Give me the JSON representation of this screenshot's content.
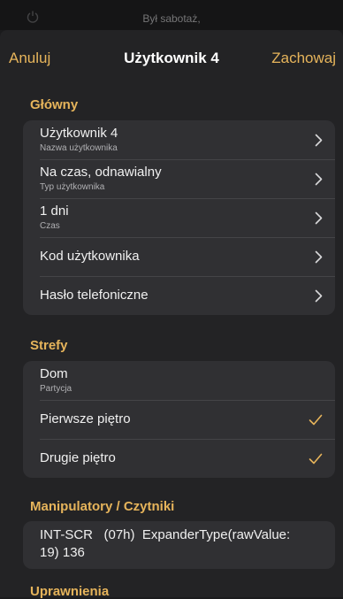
{
  "status": {
    "text": "Był sabotaż,"
  },
  "nav": {
    "cancel": "Anuluj",
    "title": "Użytkownik 4",
    "save": "Zachowaj"
  },
  "sections": {
    "main": {
      "header": "Główny",
      "rows": [
        {
          "title": "Użytkownik 4",
          "subtitle": "Nazwa użytkownika"
        },
        {
          "title": "Na czas, odnawialny",
          "subtitle": "Typ użytkownika"
        },
        {
          "title": "1 dni",
          "subtitle": "Czas"
        },
        {
          "title": "Kod użytkownika"
        },
        {
          "title": "Hasło telefoniczne"
        }
      ]
    },
    "zones": {
      "header": "Strefy",
      "rows": [
        {
          "title": "Dom",
          "subtitle": "Partycja"
        },
        {
          "title": "Pierwsze piętro",
          "checked": true
        },
        {
          "title": "Drugie piętro",
          "checked": true
        }
      ]
    },
    "keypads": {
      "header": "Manipulatory / Czytniki",
      "rows": [
        {
          "title_line1": "INT-SCR   (07h)  ExpanderType(rawValue:",
          "title_line2": "19) 136"
        }
      ]
    },
    "permissions": {
      "header": "Uprawnienia"
    }
  },
  "colors": {
    "accent": "#e6b45b",
    "background": "#232325",
    "cell": "#303033"
  },
  "icons": {
    "chevron": "chevron-right-icon",
    "check": "checkmark-icon",
    "power": "power-icon"
  }
}
